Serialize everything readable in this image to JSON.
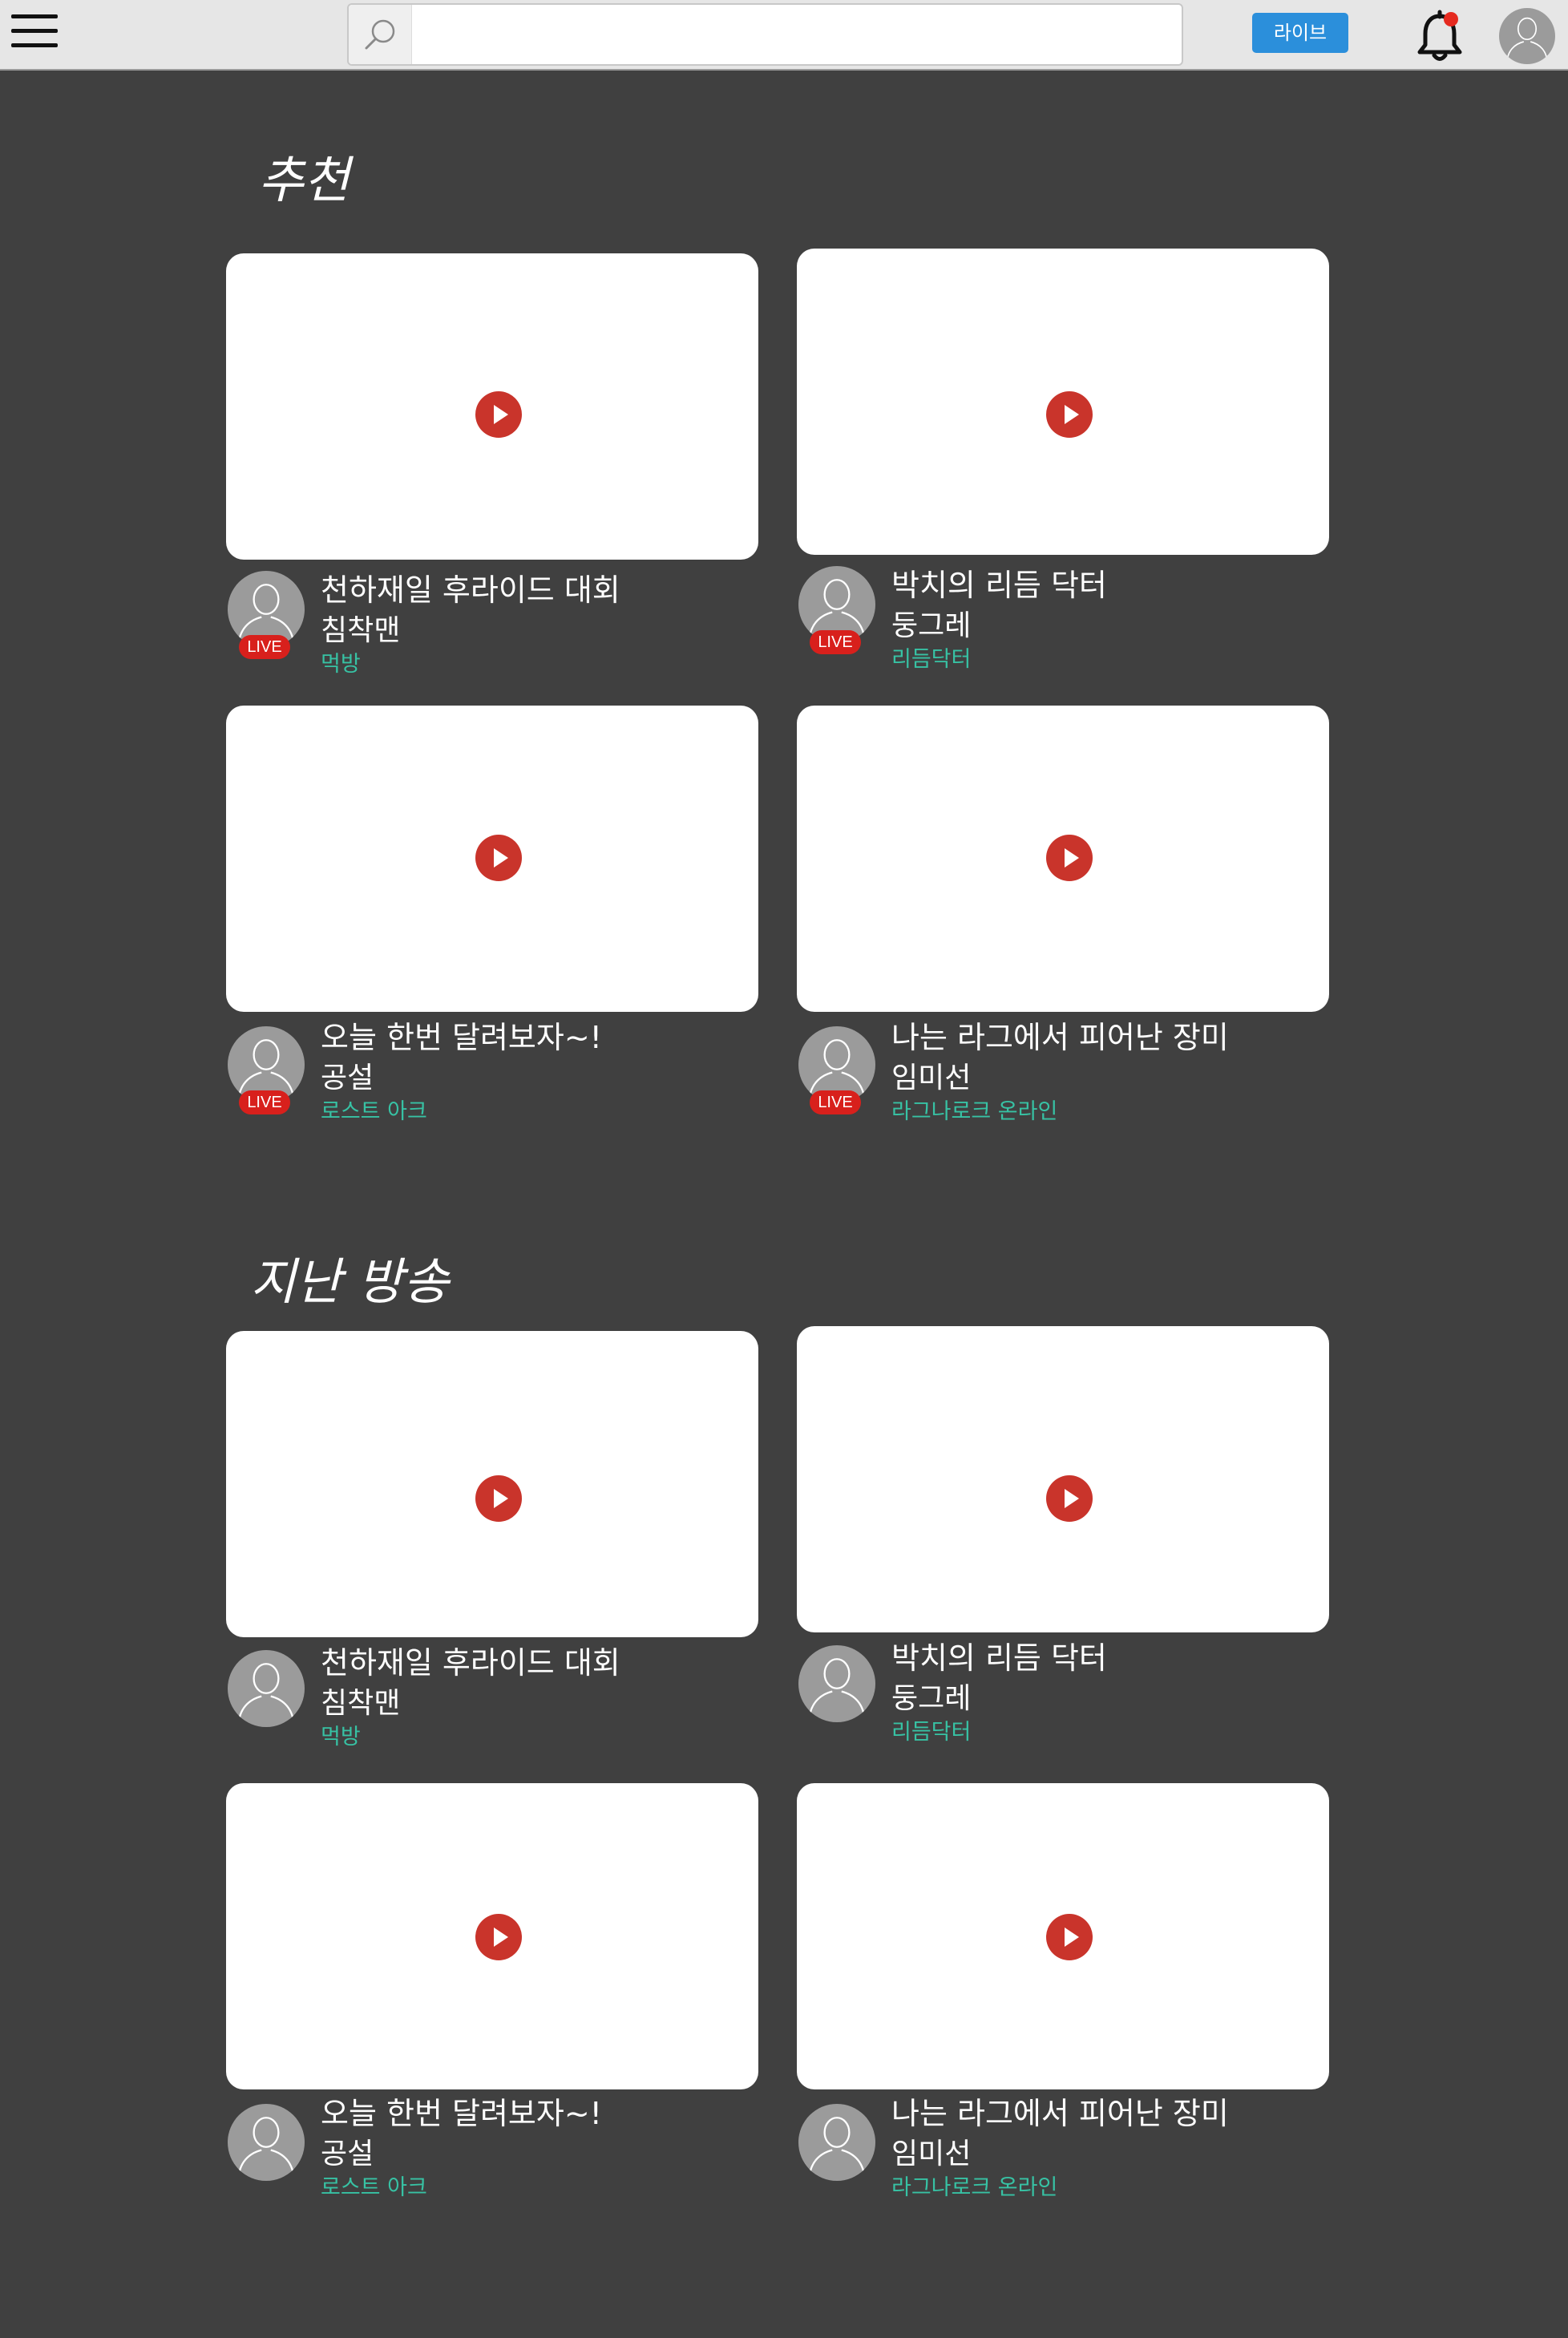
{
  "header": {
    "search_placeholder": "",
    "live_button_label": "라이브",
    "notification_dot_color": "#e52a1f",
    "icons": {
      "menu": "hamburger-menu-icon",
      "search": "magnifier-icon",
      "notifications": "bell-icon",
      "profile": "user-avatar-icon"
    }
  },
  "colors": {
    "background": "#404040",
    "accent_blue": "#2b8fdb",
    "live_red": "#d8201c",
    "play_red": "#c9342b",
    "category_teal": "#37c2a4"
  },
  "recommended": {
    "title": "추천",
    "items": [
      {
        "title": "천하재일 후라이드 대회",
        "streamer": "침착맨",
        "category": "먹방",
        "live_label": "LIVE"
      },
      {
        "title": "박치의 리듬 닥터",
        "streamer": "둥그레",
        "category": "리듬닥터",
        "live_label": "LIVE"
      },
      {
        "title": "오늘 한번 달려보자~!",
        "streamer": "공설",
        "category": "로스트 아크",
        "live_label": "LIVE"
      },
      {
        "title": "나는 라그에서 피어난 장미",
        "streamer": "임미선",
        "category": "라그나로크 온라인",
        "live_label": "LIVE"
      }
    ]
  },
  "past": {
    "title": "지난 방송",
    "items": [
      {
        "title": "천하재일 후라이드 대회",
        "streamer": "침착맨",
        "category": "먹방"
      },
      {
        "title": "박치의 리듬 닥터",
        "streamer": "둥그레",
        "category": "리듬닥터"
      },
      {
        "title": "오늘 한번 달려보자~!",
        "streamer": "공설",
        "category": "로스트 아크"
      },
      {
        "title": "나는 라그에서 피어난 장미",
        "streamer": "임미선",
        "category": "라그나로크 온라인"
      }
    ]
  }
}
